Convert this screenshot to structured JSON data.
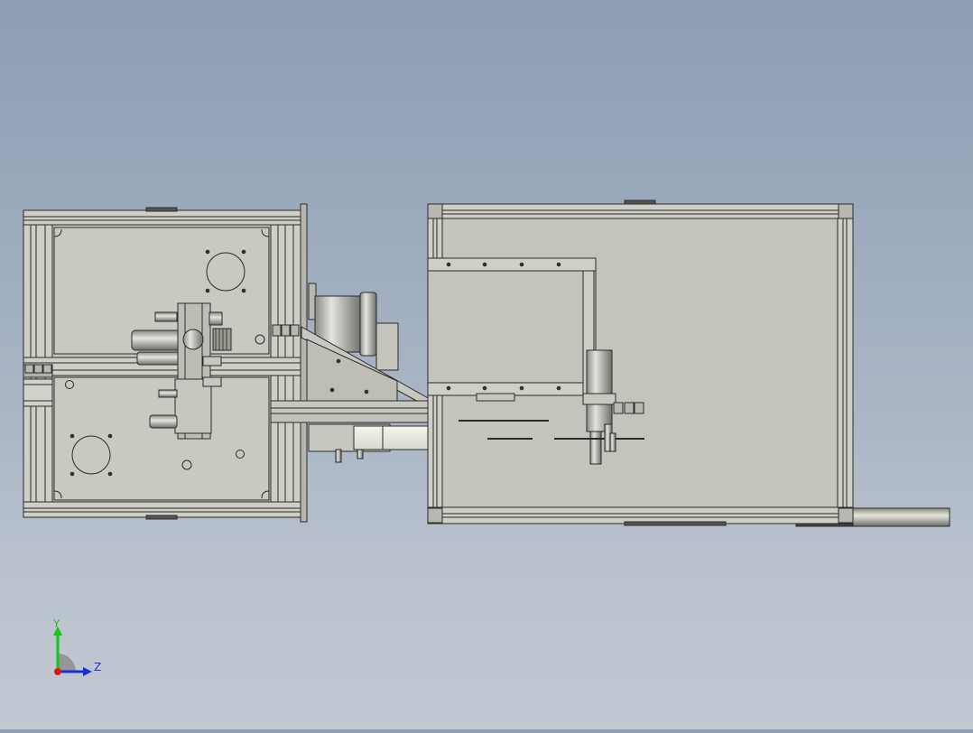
{
  "view": {
    "background_top": "#8d9db3",
    "background_bottom": "#c2c9d2",
    "part_fill": "#c4c4bc",
    "edge_color": "#2a2a2a"
  },
  "triad": {
    "y_label": "Y",
    "z_label": "Z",
    "y_color": "#18c418",
    "z_color": "#1a2fd6",
    "x_color": "#d61a1a"
  }
}
